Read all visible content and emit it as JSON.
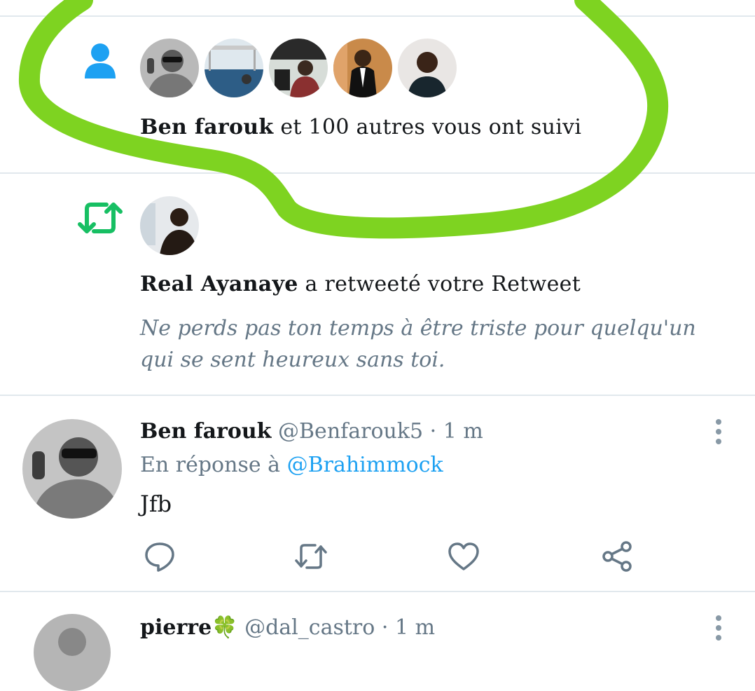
{
  "follow_notification": {
    "actor_name": "Ben farouk",
    "text": "et 100 autres vous ont suivi",
    "icon": "person-icon",
    "avatars": [
      "avatar-1",
      "avatar-2",
      "avatar-3",
      "avatar-4",
      "avatar-5"
    ]
  },
  "retweet_notification": {
    "actor_name": "Real Ayanaye",
    "text": "a retweeté votre Retweet",
    "icon": "retweet-icon",
    "tweet_text": "Ne perds pas ton temps à être triste pour quelqu'un qui se sent heureux sans toi."
  },
  "tweet": {
    "author_name": "Ben farouk",
    "handle": "@Benfarouk5",
    "separator": "·",
    "time": "1 m",
    "reply_prefix": "En réponse à",
    "reply_to": "@Brahimmock",
    "body": "Jfb",
    "actions": [
      "reply-icon",
      "retweet-icon",
      "like-icon",
      "share-icon"
    ]
  },
  "next_tweet": {
    "author_name": "pierre",
    "emoji": "🍀",
    "handle": "@dal_castro",
    "separator": "·",
    "time": "1 m"
  },
  "colors": {
    "twitter_blue": "#1da1f2",
    "retweet_green": "#17bf63",
    "highlight_green": "#7ed321",
    "muted_text": "#657786",
    "divider": "#e1e8ed"
  }
}
